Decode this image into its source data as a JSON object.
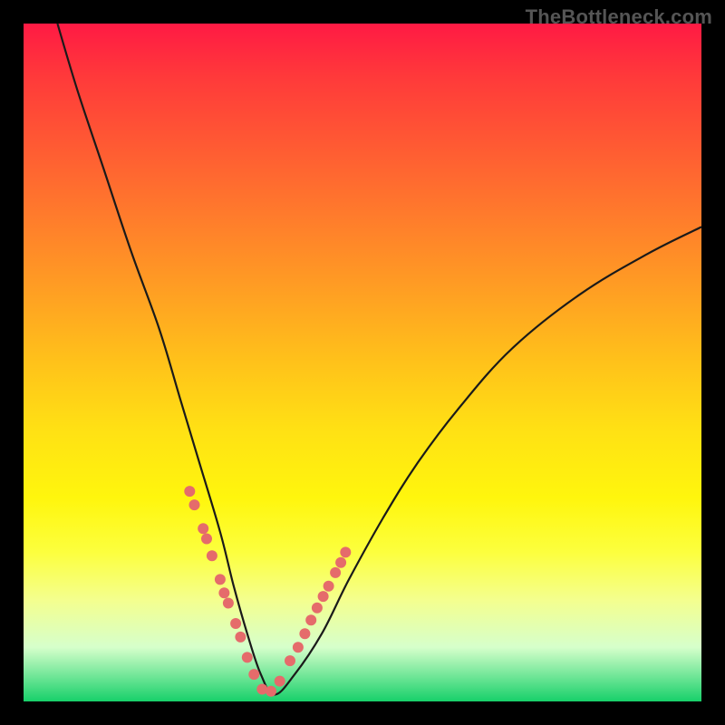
{
  "watermark": "TheBottleneck.com",
  "colors": {
    "frame": "#000000",
    "gradient_top": "#ff1a44",
    "gradient_bottom": "#17d06a",
    "curve_stroke": "#1a1a1a",
    "dot_fill": "#e56b6b"
  },
  "chart_data": {
    "type": "line",
    "title": "",
    "xlabel": "",
    "ylabel": "",
    "xlim": [
      0,
      100
    ],
    "ylim": [
      0,
      100
    ],
    "notes": "V-shaped bottleneck curve. x and y are approximate percentages of the plot area (0,0 at bottom-left). Curve descends steeply from upper-left, bottoms near x≈35 y≈1, then rises with a gradually flattening slope toward the right edge.",
    "series": [
      {
        "name": "bottleneck-curve",
        "x": [
          5,
          8,
          12,
          16,
          20,
          23,
          26,
          29,
          31,
          33,
          35,
          37,
          40,
          44,
          48,
          53,
          58,
          64,
          72,
          82,
          92,
          100
        ],
        "y": [
          100,
          90,
          78,
          66,
          55,
          45,
          35,
          25,
          17,
          10,
          4,
          1,
          4,
          10,
          18,
          27,
          35,
          43,
          52,
          60,
          66,
          70
        ]
      }
    ],
    "points": {
      "name": "highlighted-samples",
      "note": "Approximate positions of the pink sample dots visible along the curve near the valley.",
      "x": [
        24.5,
        25.2,
        26.5,
        27.0,
        27.8,
        29.0,
        29.6,
        30.2,
        31.3,
        32.0,
        33.0,
        34.0,
        35.2,
        36.5,
        37.8,
        39.3,
        40.5,
        41.5,
        42.4,
        43.3,
        44.2,
        45.0,
        46.0,
        46.8,
        47.5
      ],
      "y": [
        31.0,
        29.0,
        25.5,
        24.0,
        21.5,
        18.0,
        16.0,
        14.5,
        11.5,
        9.5,
        6.5,
        4.0,
        1.8,
        1.5,
        3.0,
        6.0,
        8.0,
        10.0,
        12.0,
        13.8,
        15.5,
        17.0,
        19.0,
        20.5,
        22.0
      ]
    }
  }
}
